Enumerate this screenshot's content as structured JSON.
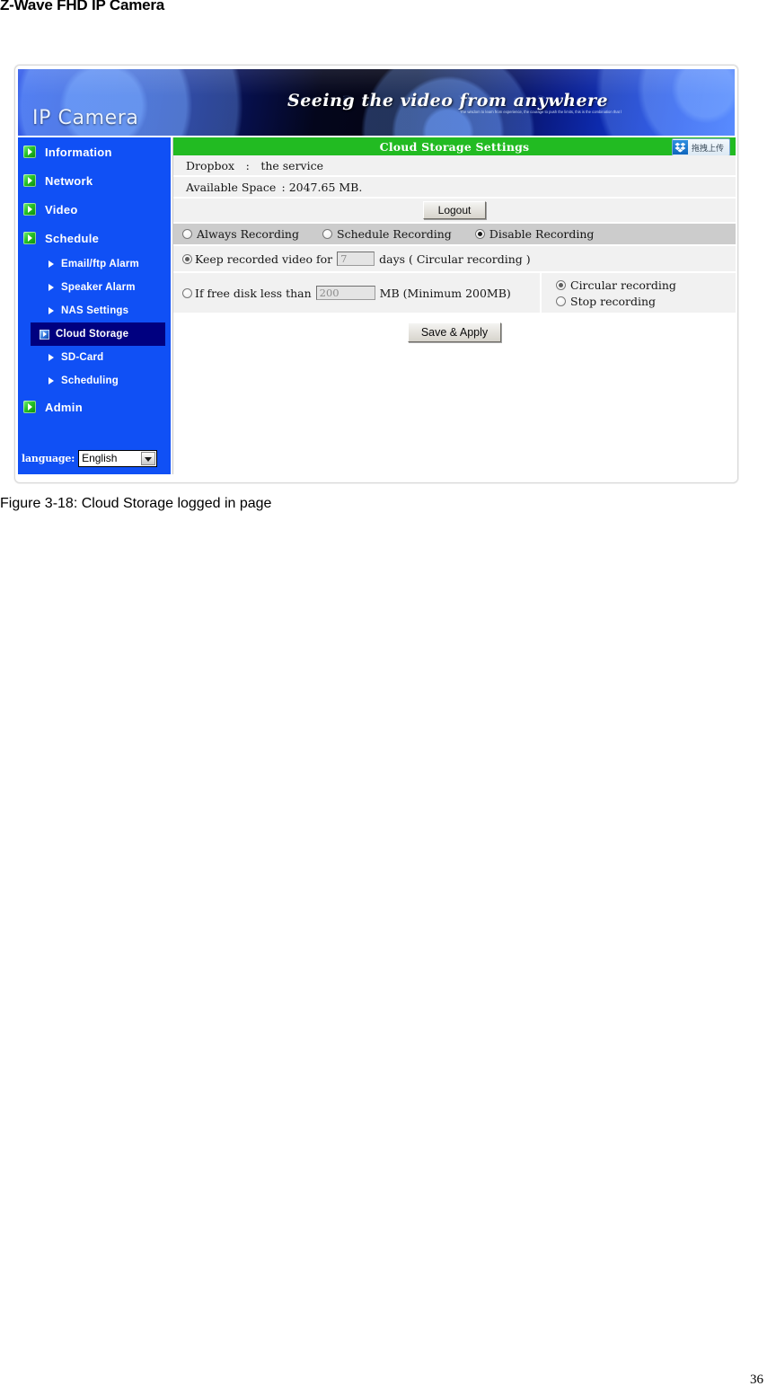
{
  "document": {
    "header_title": "Z-Wave FHD IP Camera",
    "figure_caption": "Figure 3-18: Cloud Storage logged in page",
    "page_number": "36"
  },
  "banner": {
    "logo_text": "IP Camera",
    "tagline": "Seeing the video from anywhere",
    "small_text": "The wisdom to learn from experience, the courage to push the limits, this is the combination that leads to lasting success.",
    "colors": {
      "deep_blue": "#0b1f9a",
      "dark": "#04061c",
      "bright_blue": "#1240e8"
    }
  },
  "sidebar": {
    "background_color": "#1050f5",
    "active_color": "#000080",
    "main_items": [
      {
        "label": "Information",
        "icon": "green-arrow-icon"
      },
      {
        "label": "Network",
        "icon": "green-arrow-icon"
      },
      {
        "label": "Video",
        "icon": "green-arrow-icon"
      },
      {
        "label": "Schedule",
        "icon": "green-arrow-icon"
      }
    ],
    "sub_items": [
      {
        "label": "Email/ftp Alarm",
        "active": false
      },
      {
        "label": "Speaker Alarm",
        "active": false
      },
      {
        "label": "NAS Settings",
        "active": false
      },
      {
        "label": "Cloud Storage",
        "active": true
      },
      {
        "label": "SD-Card",
        "active": false
      },
      {
        "label": "Scheduling",
        "active": false
      }
    ],
    "admin_item": {
      "label": "Admin",
      "icon": "green-arrow-icon"
    },
    "language": {
      "label": "language:",
      "selected": "English",
      "options": [
        "English"
      ]
    }
  },
  "content": {
    "panel_title": "Cloud Storage Settings",
    "panel_header_color": "#22bb22",
    "dropbox_badge": {
      "icon": "dropbox-icon",
      "text": "拖拽上传"
    },
    "info_rows": [
      {
        "label": "Dropbox : the service"
      },
      {
        "label": "Available Space : 2047.65 MB."
      }
    ],
    "logout_button": "Logout",
    "recording_modes": [
      {
        "label": "Always Recording",
        "checked": false
      },
      {
        "label": "Schedule Recording",
        "checked": false
      },
      {
        "label": "Disable Recording",
        "checked": true
      }
    ],
    "keep_option": {
      "checked": true,
      "text_before": "Keep recorded video for",
      "days_value": "7",
      "text_after": "days ( Circular recording )"
    },
    "disk_option": {
      "checked": false,
      "text_before": "If free disk less than",
      "mb_value": "200",
      "text_after": "MB (Minimum 200MB)",
      "sub_options": [
        {
          "label": "Circular recording",
          "checked": true
        },
        {
          "label": "Stop recording",
          "checked": false
        }
      ]
    },
    "apply_button": "Save & Apply"
  }
}
